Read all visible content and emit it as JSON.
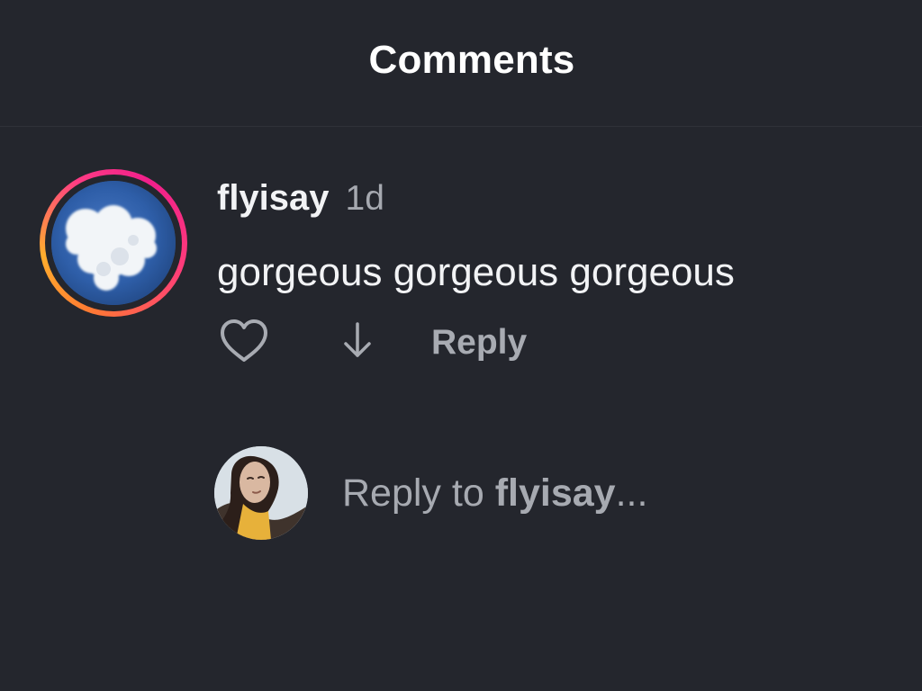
{
  "header": {
    "title": "Comments"
  },
  "comment": {
    "username": "flyisay",
    "time": "1d",
    "text": "gorgeous gorgeous gorgeous",
    "reply_label": "Reply",
    "avatar_image": "heart-shaped-cloud",
    "icons": {
      "like": "heart-outline-icon",
      "download": "arrow-down-icon"
    }
  },
  "composer": {
    "prefix": "Reply to",
    "target": "flyisay",
    "suffix": "...",
    "avatar_image": "user-portrait"
  },
  "colors": {
    "background": "#24262d",
    "text_primary": "#f2f3f5",
    "text_secondary": "#a8abb2",
    "story_ring_start": "#f01f8b",
    "story_ring_end": "#ffae2d"
  }
}
